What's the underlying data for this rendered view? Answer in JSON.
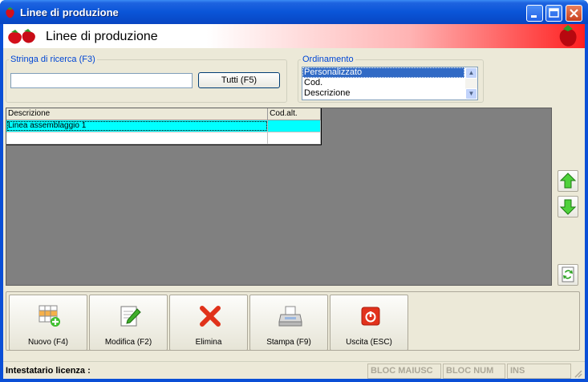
{
  "window": {
    "title": "Linee di produzione"
  },
  "header": {
    "title": "Linee di produzione"
  },
  "search": {
    "legend": "Stringa di ricerca (F3)",
    "value": "",
    "all_button": "Tutti (F5)"
  },
  "ordering": {
    "legend": "Ordinamento",
    "options": [
      "Personalizzato",
      "Cod.",
      "Descrizione"
    ],
    "selected": "Personalizzato"
  },
  "grid": {
    "columns": [
      "Descrizione",
      "Cod.alt."
    ],
    "rows": [
      [
        "Linea assemblaggio 1",
        ""
      ],
      [
        "",
        ""
      ]
    ]
  },
  "toolbar": {
    "new": "Nuovo (F4)",
    "edit": "Modifica (F2)",
    "delete": "Elimina",
    "print": "Stampa (F9)",
    "exit": "Uscita (ESC)"
  },
  "status": {
    "license": "Intestatario licenza :",
    "caps": "BLOC MAIUSC",
    "num": "BLOC NUM",
    "ins": "INS"
  },
  "colors": {
    "accent": "#0a55d8",
    "selected_row": "#00ffff",
    "header_red": "#ff2020"
  }
}
